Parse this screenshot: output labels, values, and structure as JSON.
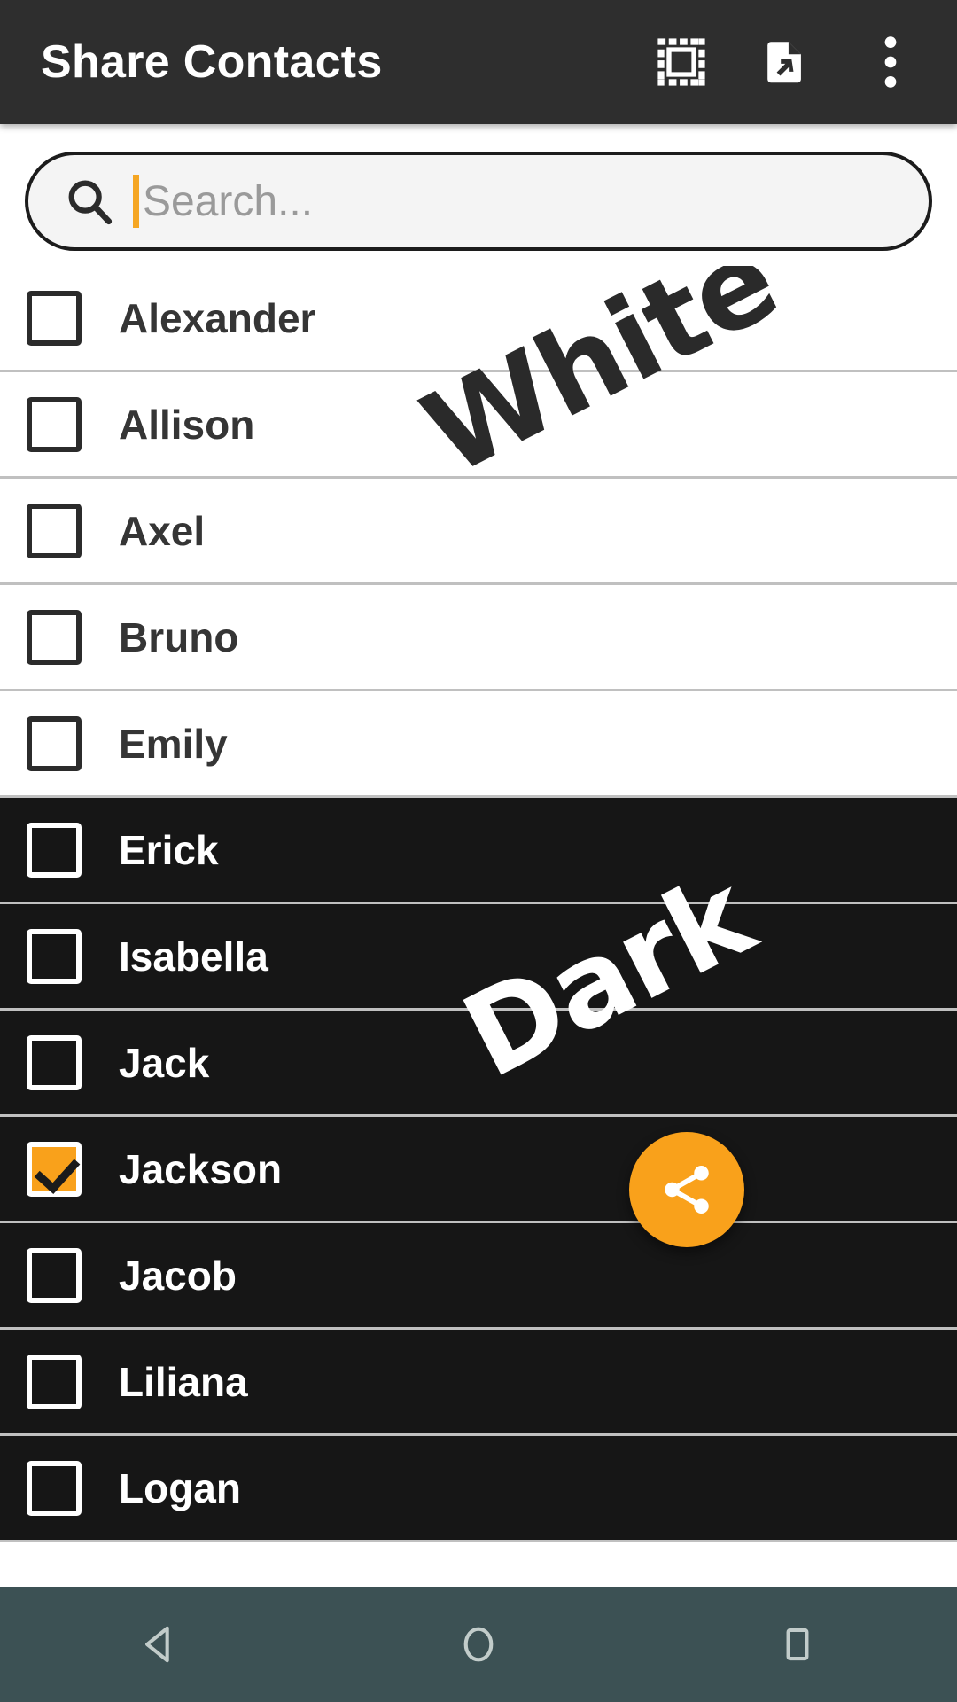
{
  "appbar": {
    "title": "Share Contacts",
    "actions": [
      {
        "name": "select-all-icon",
        "label": "Select all"
      },
      {
        "name": "file-export-icon",
        "label": "Export to file"
      },
      {
        "name": "overflow-menu-icon",
        "label": "More options"
      }
    ]
  },
  "search": {
    "placeholder": "Search...",
    "value": "",
    "icon": "search-icon",
    "caret_color": "#F5A623"
  },
  "contacts": [
    {
      "name": "Alexander",
      "checked": false,
      "theme": "light"
    },
    {
      "name": "Allison",
      "checked": false,
      "theme": "light"
    },
    {
      "name": "Axel",
      "checked": false,
      "theme": "light"
    },
    {
      "name": "Bruno",
      "checked": false,
      "theme": "light"
    },
    {
      "name": "Emily",
      "checked": false,
      "theme": "light"
    },
    {
      "name": "Erick",
      "checked": false,
      "theme": "dark"
    },
    {
      "name": "Isabella",
      "checked": false,
      "theme": "dark"
    },
    {
      "name": "Jack",
      "checked": false,
      "theme": "dark"
    },
    {
      "name": "Jackson",
      "checked": true,
      "theme": "dark"
    },
    {
      "name": "Jacob",
      "checked": false,
      "theme": "dark"
    },
    {
      "name": "Liliana",
      "checked": false,
      "theme": "dark"
    },
    {
      "name": "Logan",
      "checked": false,
      "theme": "dark"
    }
  ],
  "watermarks": {
    "light_label": "White",
    "dark_label": "Dark"
  },
  "fab": {
    "icon": "share-icon",
    "label": "Share",
    "color": "#F9A11B"
  },
  "navbar": {
    "buttons": [
      {
        "name": "nav-back-button",
        "label": "Back"
      },
      {
        "name": "nav-home-button",
        "label": "Home"
      },
      {
        "name": "nav-recents-button",
        "label": "Recents"
      }
    ]
  },
  "colors": {
    "appbar_bg": "#2e2e2e",
    "accent": "#F9A11B",
    "light_row_bg": "#ffffff",
    "dark_row_bg": "#161616",
    "divider": "#c0c0c0",
    "navbar_bg": "#3c5154"
  }
}
